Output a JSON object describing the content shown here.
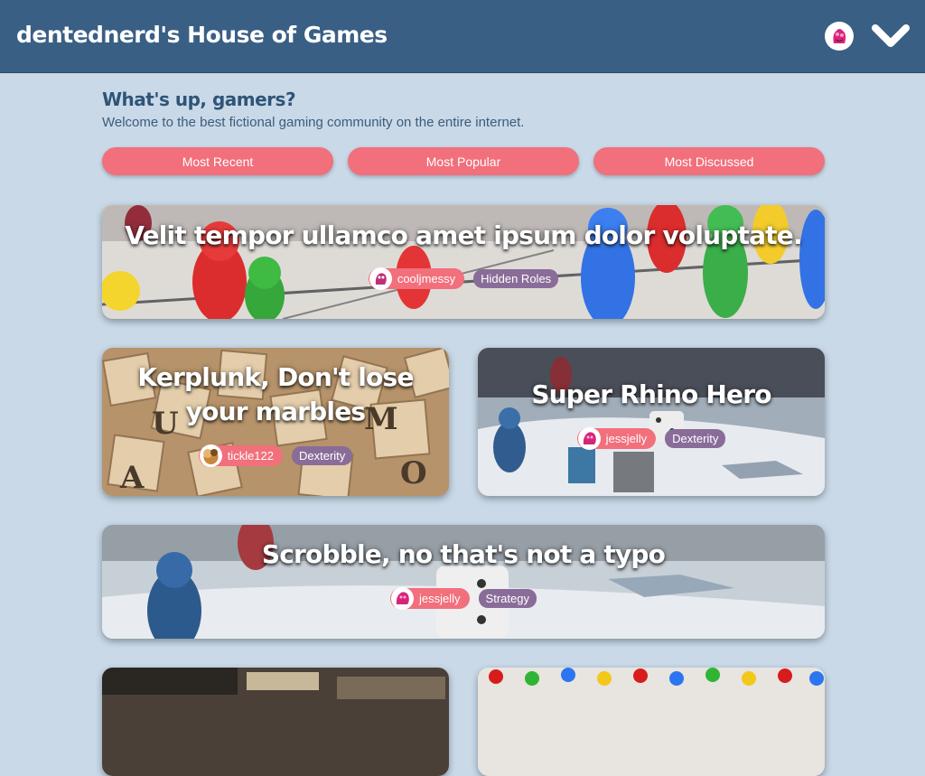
{
  "header": {
    "title": "dentednerd's House of Games"
  },
  "intro": {
    "heading": "What's up, gamers?",
    "subtitle": "Welcome to the best fictional gaming community on the entire internet."
  },
  "sort_buttons": [
    "Most Recent",
    "Most Popular",
    "Most Discussed"
  ],
  "reviews": [
    {
      "title": "Velit tempor ullamco amet ipsum dolor voluptate.",
      "author": "cooljmessy",
      "category": "Hidden Roles"
    },
    {
      "title": "Kerplunk, Don't lose your marbles",
      "author": "tickle122",
      "category": "Dexterity"
    },
    {
      "title": "Super Rhino Hero",
      "author": "jessjelly",
      "category": "Dexterity"
    },
    {
      "title": "Scrobble, no that's not a typo",
      "author": "jessjelly",
      "category": "Strategy"
    },
    {
      "title": "",
      "author": "",
      "category": ""
    },
    {
      "title": "",
      "author": "",
      "category": ""
    }
  ],
  "colors": {
    "header_bg": "#3a5f85",
    "page_bg": "#c9d9e8",
    "accent_pink": "#f26f7c",
    "category_purple": "#8a6c98"
  }
}
